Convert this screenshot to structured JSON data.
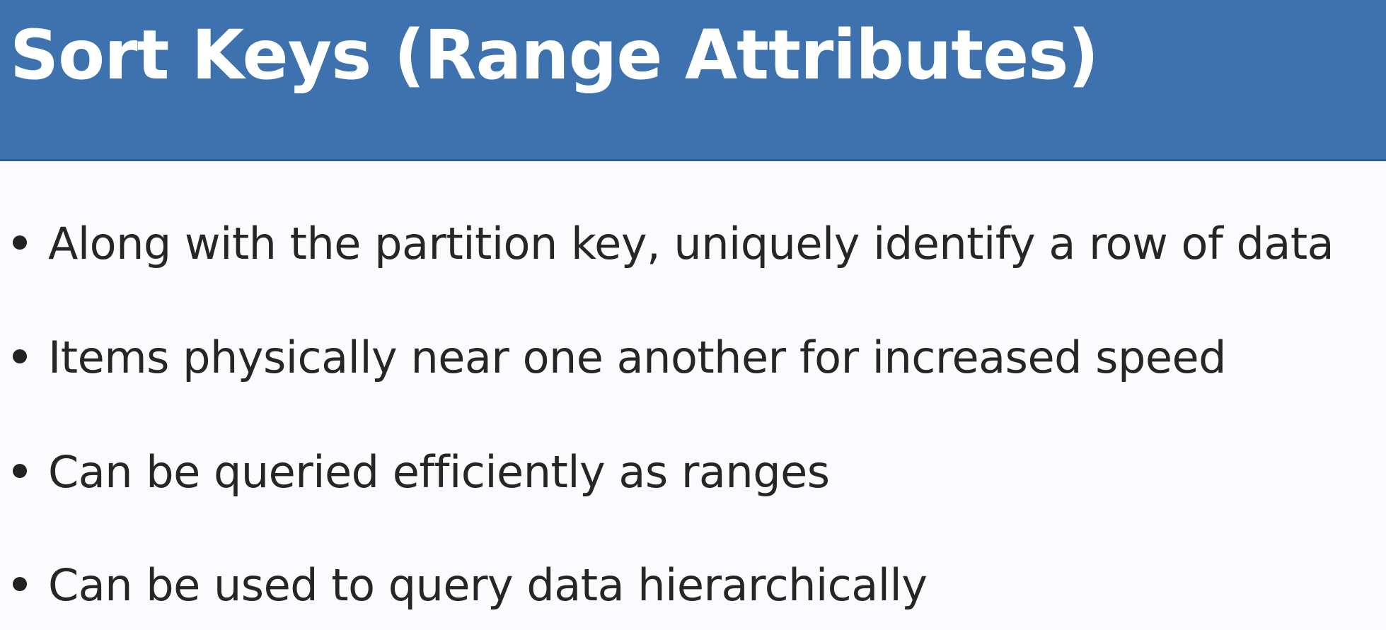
{
  "slide": {
    "title": "Sort Keys (Range Attributes)",
    "bullets": [
      "Along with the partition key, uniquely identify a row of data",
      "Items physically near one another for increased speed",
      "Can be queried efficiently as ranges",
      "Can be used to query data hierarchically"
    ]
  },
  "colors": {
    "title_bar": "#3d72ae",
    "title_text": "#ffffff",
    "body_text": "#262626",
    "background": "#fbfbfd"
  }
}
